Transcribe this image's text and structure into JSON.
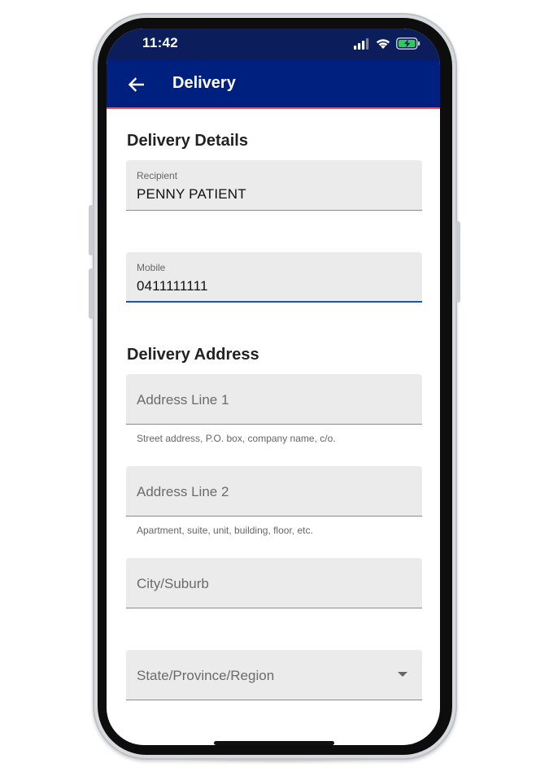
{
  "status_bar": {
    "time": "11:42"
  },
  "app_bar": {
    "title": "Delivery"
  },
  "delivery_details": {
    "title": "Delivery Details",
    "recipient": {
      "label": "Recipient",
      "value": "PENNY PATIENT"
    },
    "mobile": {
      "label": "Mobile",
      "value": "0411111111"
    }
  },
  "delivery_address": {
    "title": "Delivery Address",
    "address_line_1": {
      "placeholder": "Address Line 1",
      "hint": "Street address, P.O. box, company name, c/o."
    },
    "address_line_2": {
      "placeholder": "Address Line 2",
      "hint": "Apartment, suite, unit, building, floor, etc."
    },
    "city": {
      "placeholder": "City/Suburb"
    },
    "state": {
      "placeholder": "State/Province/Region"
    }
  },
  "colors": {
    "status_bar": "#0b1e5b",
    "app_bar": "#00207f",
    "app_bar_underline": "#e05a6e",
    "field_bg": "#ebebeb",
    "focus_underline": "#1d56a8"
  }
}
